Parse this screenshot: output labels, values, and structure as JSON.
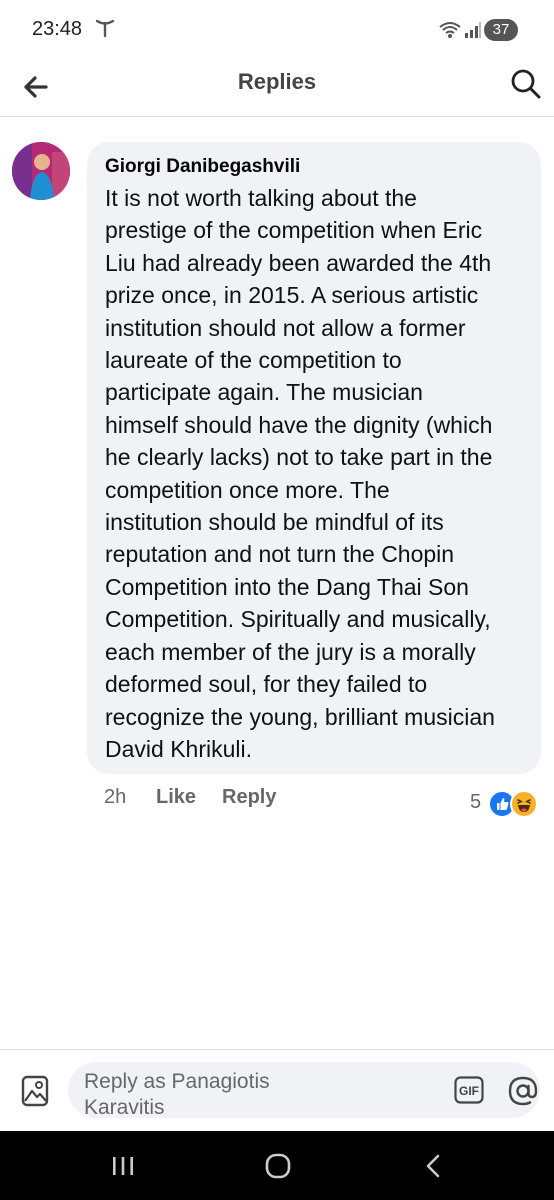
{
  "status_bar": {
    "time": "23:48",
    "battery": "37",
    "icons": [
      "carrier-icon",
      "wifi-icon",
      "signal-icon",
      "battery-icon"
    ]
  },
  "header": {
    "title": "Replies",
    "icons": [
      "back-arrow-icon",
      "search-icon"
    ]
  },
  "comment": {
    "author": "Giorgi Danibegashvili",
    "text_lines": [
      "It is not worth talking about the",
      "prestige of the competition when Eric",
      "Liu had already been awarded the 4th",
      "prize once, in 2015. A serious artistic",
      "institution should not allow a former",
      "laureate of the competition to",
      "participate again. The musician",
      "himself should have the dignity (which",
      "he clearly lacks) not to take part in the",
      "competition once more. The",
      "institution should be mindful of its",
      "reputation and not turn the Chopin",
      "Competition into the Dang Thai Son",
      "Competition. Spiritually and musically,",
      "each member of the jury is a morally",
      "deformed soul, for they failed to",
      "recognize the young, brilliant musician",
      "David Khrikuli."
    ],
    "time": "2h",
    "like_label": "Like",
    "reply_label": "Reply",
    "reaction_count": "5",
    "reactions": [
      "like-reaction-icon",
      "haha-reaction-icon"
    ]
  },
  "composer": {
    "placeholder_lines": [
      "Reply as Panagiotis",
      "Karavitis"
    ],
    "gif_label": "GIF",
    "icons": [
      "photo-icon",
      "gif-icon",
      "at-mention-icon",
      "emoji-icon"
    ]
  },
  "navbar": {
    "icons": [
      "recent-apps-icon",
      "home-icon",
      "nav-back-icon"
    ]
  },
  "colors": {
    "bubble": "#f0f2f5",
    "secondary_text": "#65676b",
    "like_blue": "#1877f2",
    "haha_yellow": "#f7b125"
  }
}
